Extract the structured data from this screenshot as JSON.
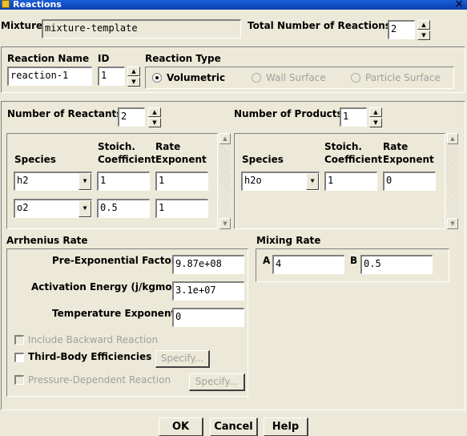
{
  "window": {
    "title": "Reactions",
    "close_glyph": "×"
  },
  "mixture": {
    "label": "Mixture",
    "value": "mixture-template"
  },
  "total_reactions": {
    "label": "Total Number of Reactions",
    "value": "2"
  },
  "reaction": {
    "name_label": "Reaction Name",
    "name_value": "reaction-1",
    "id_label": "ID",
    "id_value": "1"
  },
  "reaction_type": {
    "label": "Reaction Type",
    "options": [
      "Volumetric",
      "Wall Surface",
      "Particle Surface"
    ],
    "selected": "Volumetric"
  },
  "reactants": {
    "count_label": "Number of Reactants",
    "count_value": "2",
    "headers": {
      "species": "Species",
      "stoich1": "Stoich.",
      "stoich2": "Coefficient",
      "rate1": "Rate",
      "rate2": "Exponent"
    },
    "rows": [
      {
        "species": "h2",
        "coefficient": "1",
        "exponent": "1"
      },
      {
        "species": "o2",
        "coefficient": "0.5",
        "exponent": "1"
      }
    ]
  },
  "products": {
    "count_label": "Number of Products",
    "count_value": "1",
    "headers": {
      "species": "Species",
      "stoich1": "Stoich.",
      "stoich2": "Coefficient",
      "rate1": "Rate",
      "rate2": "Exponent"
    },
    "rows": [
      {
        "species": "h2o",
        "coefficient": "1",
        "exponent": "0"
      }
    ]
  },
  "arrhenius": {
    "label": "Arrhenius Rate",
    "pre_exp_label": "Pre-Exponential Factor",
    "pre_exp_value": "9.87e+08",
    "activation_label": "Activation Energy (j/kgmol)",
    "activation_value": "3.1e+07",
    "temp_exp_label": "Temperature Exponent",
    "temp_exp_value": "0",
    "include_backward": "Include Backward Reaction",
    "third_body": "Third-Body Efficiencies",
    "pressure_dependent": "Pressure-Dependent Reaction",
    "specify_label": "Specify..."
  },
  "mixing_rate": {
    "label": "Mixing Rate",
    "a_label": "A",
    "a_value": "4",
    "b_label": "B",
    "b_value": "0.5"
  },
  "buttons": {
    "ok": "OK",
    "cancel": "Cancel",
    "help": "Help"
  }
}
